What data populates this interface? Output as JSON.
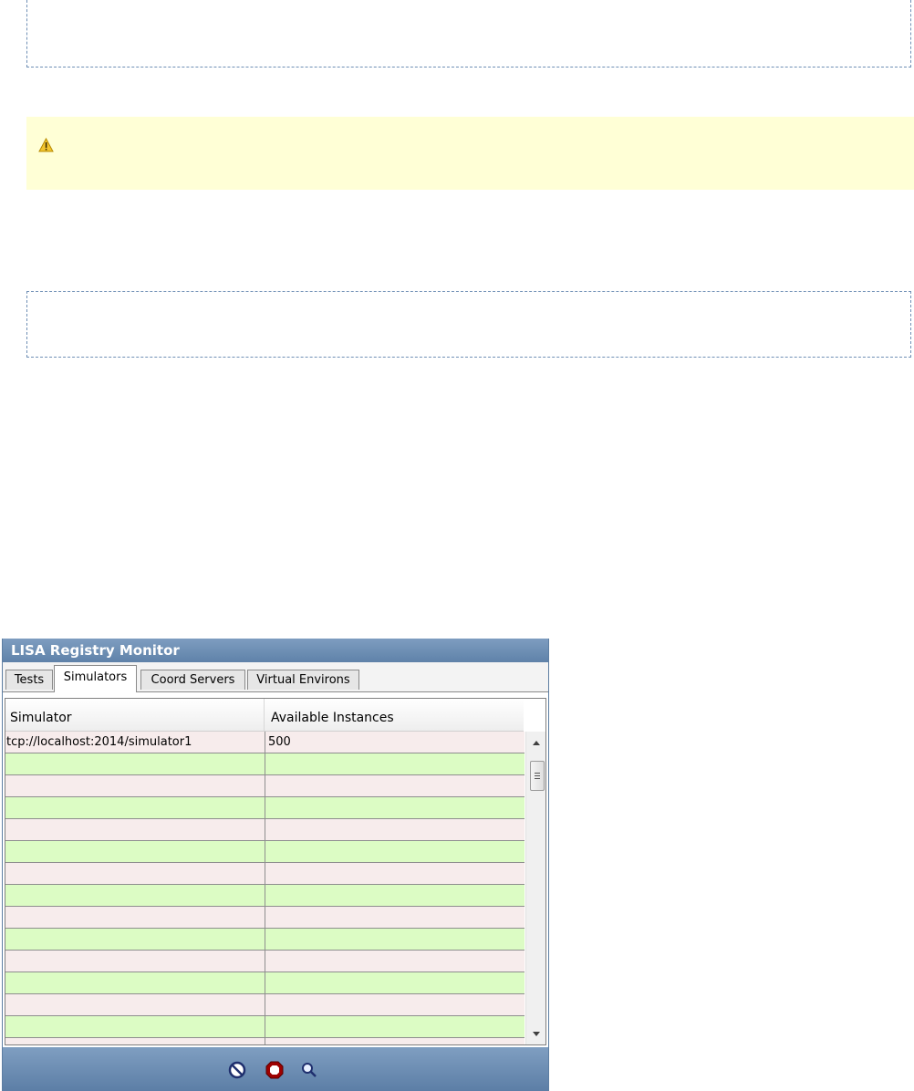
{
  "monitor": {
    "title": "LISA Registry Monitor",
    "tabs": [
      {
        "label": "Tests",
        "active": false
      },
      {
        "label": "Simulators",
        "active": true
      },
      {
        "label": "Coord Servers",
        "active": false
      },
      {
        "label": "Virtual Environs",
        "active": false
      }
    ],
    "table": {
      "columns": [
        "Simulator",
        "Available Instances"
      ],
      "rows": [
        [
          "tcp://localhost:2014/simulator1",
          "500"
        ],
        [
          "",
          ""
        ],
        [
          "",
          ""
        ],
        [
          "",
          ""
        ],
        [
          "",
          ""
        ],
        [
          "",
          ""
        ],
        [
          "",
          ""
        ],
        [
          "",
          ""
        ],
        [
          "",
          ""
        ],
        [
          "",
          ""
        ],
        [
          "",
          ""
        ],
        [
          "",
          ""
        ],
        [
          "",
          ""
        ],
        [
          "",
          ""
        ],
        [
          "",
          ""
        ]
      ],
      "row_colors": {
        "odd": "#f7ecec",
        "even": "#dcfcc4"
      }
    },
    "footer_icons": [
      "cancel-icon",
      "stop-icon",
      "search-icon"
    ]
  },
  "warning": {
    "icon": "warning-icon",
    "background": "#ffffd6"
  }
}
